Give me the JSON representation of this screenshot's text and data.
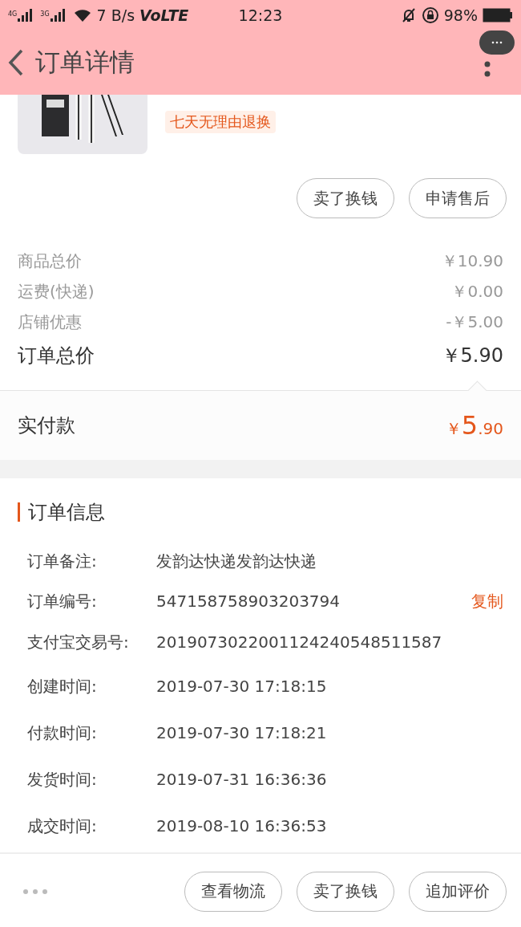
{
  "status_bar": {
    "sim1": "4G",
    "sim2": "3G",
    "speed": "7 B/s",
    "volte": "VoLTE",
    "time": "12:23",
    "battery": "98%"
  },
  "header": {
    "title": "订单详情"
  },
  "product": {
    "image": {
      "kind": "picture"
    },
    "badge": "七天无理由退换",
    "actions": [
      "卖了换钱",
      "申请售后"
    ]
  },
  "prices": [
    {
      "label": "商品总价",
      "value": "￥10.90",
      "kind": "minor"
    },
    {
      "label": "运费(快递)",
      "value": "￥0.00",
      "kind": "minor"
    },
    {
      "label": "店铺优惠",
      "value": "-￥5.00",
      "kind": "minor"
    },
    {
      "label": "订单总价",
      "value": "￥5.90",
      "kind": "total"
    }
  ],
  "paid": {
    "label": "实付款",
    "currency": "￥",
    "integer": "5",
    "decimal": ".90"
  },
  "order_info": {
    "title": "订单信息",
    "rows": [
      {
        "label": "订单备注:",
        "value": "发韵达快递发韵达快递"
      },
      {
        "label": "订单编号:",
        "value": "547158758903203794",
        "action": "复制"
      },
      {
        "label": "支付宝交易号:",
        "value": "2019073022001124240548511587"
      },
      {
        "label": "创建时间:",
        "value": "2019-07-30 17:18:15"
      },
      {
        "label": "付款时间:",
        "value": "2019-07-30 17:18:21"
      },
      {
        "label": "发货时间:",
        "value": "2019-07-31 16:36:36"
      },
      {
        "label": "成交时间:",
        "value": "2019-08-10 16:36:53"
      }
    ]
  },
  "bottom_bar": {
    "buttons": [
      "查看物流",
      "卖了换钱",
      "追加评价"
    ]
  }
}
